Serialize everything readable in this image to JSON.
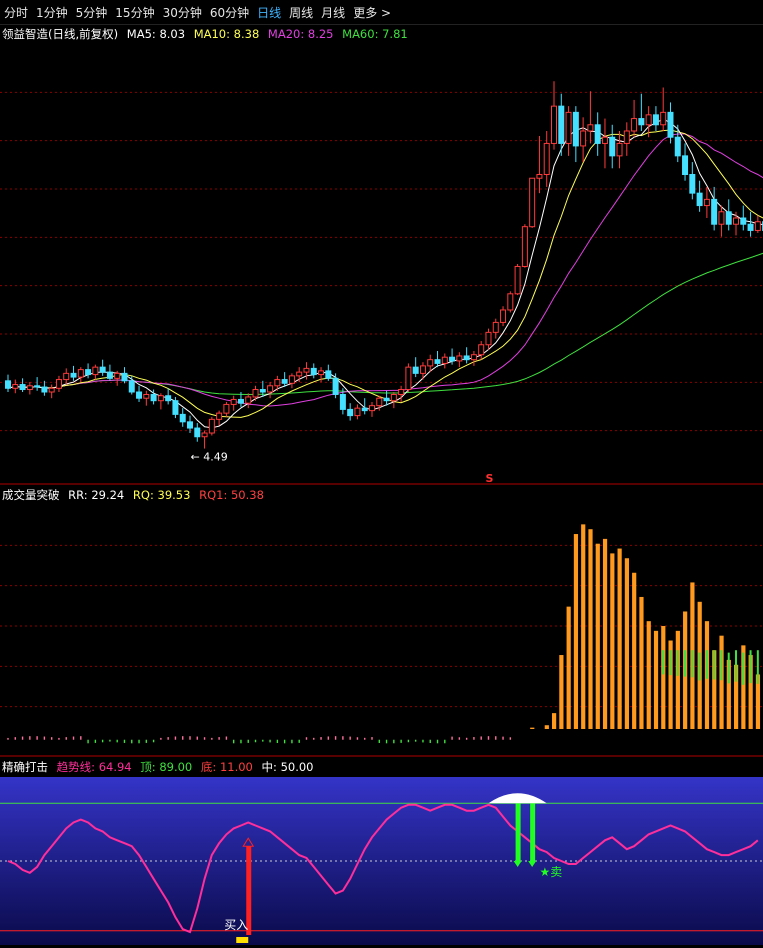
{
  "toolbar": {
    "items": [
      "分时",
      "1分钟",
      "5分钟",
      "15分钟",
      "30分钟",
      "60分钟",
      "日线",
      "周线",
      "月线",
      "更多 >"
    ],
    "active_index": 6
  },
  "colors": {
    "up": "#ff3b3b",
    "down": "#45e0ff",
    "ma5": "#ffffff",
    "ma10": "#ffff55",
    "ma20": "#e040e0",
    "ma60": "#3fe03f",
    "grid": "#8b0000",
    "orange": "#ff9a1e",
    "green_bar": "#3fe03f",
    "osc_line": "#ff2e9a"
  },
  "main": {
    "title": "领益智造(日线,前复权)",
    "ma5_label": "MA5:",
    "ma5_value": "8.03",
    "ma10_label": "MA10:",
    "ma10_value": "8.38",
    "ma20_label": "MA20:",
    "ma20_value": "8.25",
    "ma60_label": "MA60:",
    "ma60_value": "7.81",
    "low_annotation": "4.49",
    "marker_s": "S"
  },
  "volume": {
    "title": "成交量突破",
    "rr_label": "RR:",
    "rr_value": "29.24",
    "rq_label": "RQ:",
    "rq_value": "39.53",
    "rq1_label": "RQ1:",
    "rq1_value": "50.38"
  },
  "osc": {
    "title": "精确打击",
    "trend_label": "趋势线:",
    "trend_value": "64.94",
    "top_label": "顶:",
    "top_value": "89.00",
    "bottom_label": "底:",
    "bottom_value": "11.00",
    "mid_label": "中:",
    "mid_value": "50.00",
    "buy_label": "买入",
    "sell_label": "★卖"
  },
  "chart_data": [
    {
      "type": "candlestick",
      "title": "领益智造(日线,前复权)",
      "x": "trading day index",
      "ylim": [
        4.0,
        11.0
      ],
      "candles": [
        {
          "o": 5.58,
          "h": 5.68,
          "l": 5.4,
          "c": 5.46
        },
        {
          "o": 5.46,
          "h": 5.6,
          "l": 5.38,
          "c": 5.52
        },
        {
          "o": 5.52,
          "h": 5.62,
          "l": 5.4,
          "c": 5.44
        },
        {
          "o": 5.44,
          "h": 5.56,
          "l": 5.36,
          "c": 5.5
        },
        {
          "o": 5.5,
          "h": 5.64,
          "l": 5.42,
          "c": 5.48
        },
        {
          "o": 5.48,
          "h": 5.58,
          "l": 5.34,
          "c": 5.4
        },
        {
          "o": 5.4,
          "h": 5.52,
          "l": 5.3,
          "c": 5.46
        },
        {
          "o": 5.46,
          "h": 5.66,
          "l": 5.4,
          "c": 5.6
        },
        {
          "o": 5.6,
          "h": 5.78,
          "l": 5.52,
          "c": 5.7
        },
        {
          "o": 5.7,
          "h": 5.82,
          "l": 5.58,
          "c": 5.64
        },
        {
          "o": 5.64,
          "h": 5.8,
          "l": 5.56,
          "c": 5.76
        },
        {
          "o": 5.76,
          "h": 5.86,
          "l": 5.62,
          "c": 5.68
        },
        {
          "o": 5.68,
          "h": 5.84,
          "l": 5.6,
          "c": 5.8
        },
        {
          "o": 5.8,
          "h": 5.92,
          "l": 5.66,
          "c": 5.72
        },
        {
          "o": 5.72,
          "h": 5.84,
          "l": 5.58,
          "c": 5.62
        },
        {
          "o": 5.62,
          "h": 5.74,
          "l": 5.5,
          "c": 5.7
        },
        {
          "o": 5.7,
          "h": 5.8,
          "l": 5.54,
          "c": 5.58
        },
        {
          "o": 5.58,
          "h": 5.66,
          "l": 5.36,
          "c": 5.4
        },
        {
          "o": 5.4,
          "h": 5.5,
          "l": 5.24,
          "c": 5.3
        },
        {
          "o": 5.3,
          "h": 5.42,
          "l": 5.18,
          "c": 5.36
        },
        {
          "o": 5.36,
          "h": 5.44,
          "l": 5.2,
          "c": 5.26
        },
        {
          "o": 5.26,
          "h": 5.38,
          "l": 5.12,
          "c": 5.34
        },
        {
          "o": 5.34,
          "h": 5.46,
          "l": 5.2,
          "c": 5.26
        },
        {
          "o": 5.26,
          "h": 5.32,
          "l": 4.98,
          "c": 5.04
        },
        {
          "o": 5.04,
          "h": 5.14,
          "l": 4.84,
          "c": 4.92
        },
        {
          "o": 4.92,
          "h": 5.02,
          "l": 4.74,
          "c": 4.82
        },
        {
          "o": 4.82,
          "h": 4.9,
          "l": 4.6,
          "c": 4.68
        },
        {
          "o": 4.68,
          "h": 4.78,
          "l": 4.49,
          "c": 4.74
        },
        {
          "o": 4.74,
          "h": 5.0,
          "l": 4.7,
          "c": 4.96
        },
        {
          "o": 4.96,
          "h": 5.1,
          "l": 4.86,
          "c": 5.06
        },
        {
          "o": 5.06,
          "h": 5.24,
          "l": 5.0,
          "c": 5.2
        },
        {
          "o": 5.2,
          "h": 5.34,
          "l": 5.1,
          "c": 5.28
        },
        {
          "o": 5.28,
          "h": 5.4,
          "l": 5.16,
          "c": 5.22
        },
        {
          "o": 5.22,
          "h": 5.38,
          "l": 5.14,
          "c": 5.32
        },
        {
          "o": 5.32,
          "h": 5.5,
          "l": 5.26,
          "c": 5.44
        },
        {
          "o": 5.44,
          "h": 5.58,
          "l": 5.32,
          "c": 5.4
        },
        {
          "o": 5.4,
          "h": 5.56,
          "l": 5.3,
          "c": 5.5
        },
        {
          "o": 5.5,
          "h": 5.66,
          "l": 5.42,
          "c": 5.6
        },
        {
          "o": 5.6,
          "h": 5.72,
          "l": 5.48,
          "c": 5.54
        },
        {
          "o": 5.54,
          "h": 5.7,
          "l": 5.46,
          "c": 5.66
        },
        {
          "o": 5.66,
          "h": 5.8,
          "l": 5.56,
          "c": 5.72
        },
        {
          "o": 5.72,
          "h": 5.88,
          "l": 5.6,
          "c": 5.78
        },
        {
          "o": 5.78,
          "h": 5.86,
          "l": 5.62,
          "c": 5.68
        },
        {
          "o": 5.68,
          "h": 5.8,
          "l": 5.56,
          "c": 5.74
        },
        {
          "o": 5.74,
          "h": 5.84,
          "l": 5.58,
          "c": 5.62
        },
        {
          "o": 5.62,
          "h": 5.7,
          "l": 5.3,
          "c": 5.36
        },
        {
          "o": 5.36,
          "h": 5.46,
          "l": 5.04,
          "c": 5.12
        },
        {
          "o": 5.12,
          "h": 5.22,
          "l": 4.94,
          "c": 5.02
        },
        {
          "o": 5.02,
          "h": 5.2,
          "l": 4.96,
          "c": 5.14
        },
        {
          "o": 5.14,
          "h": 5.3,
          "l": 5.04,
          "c": 5.1
        },
        {
          "o": 5.1,
          "h": 5.24,
          "l": 5.0,
          "c": 5.18
        },
        {
          "o": 5.18,
          "h": 5.34,
          "l": 5.1,
          "c": 5.3
        },
        {
          "o": 5.3,
          "h": 5.42,
          "l": 5.18,
          "c": 5.26
        },
        {
          "o": 5.26,
          "h": 5.4,
          "l": 5.14,
          "c": 5.36
        },
        {
          "o": 5.36,
          "h": 5.5,
          "l": 5.24,
          "c": 5.44
        },
        {
          "o": 5.44,
          "h": 5.86,
          "l": 5.4,
          "c": 5.8
        },
        {
          "o": 5.8,
          "h": 5.96,
          "l": 5.64,
          "c": 5.7
        },
        {
          "o": 5.7,
          "h": 5.88,
          "l": 5.6,
          "c": 5.82
        },
        {
          "o": 5.82,
          "h": 6.0,
          "l": 5.72,
          "c": 5.92
        },
        {
          "o": 5.92,
          "h": 6.06,
          "l": 5.8,
          "c": 5.86
        },
        {
          "o": 5.86,
          "h": 6.02,
          "l": 5.78,
          "c": 5.96
        },
        {
          "o": 5.96,
          "h": 6.1,
          "l": 5.84,
          "c": 5.9
        },
        {
          "o": 5.9,
          "h": 6.04,
          "l": 5.8,
          "c": 5.98
        },
        {
          "o": 5.98,
          "h": 6.12,
          "l": 5.86,
          "c": 5.92
        },
        {
          "o": 5.92,
          "h": 6.06,
          "l": 5.82,
          "c": 6.0
        },
        {
          "o": 6.0,
          "h": 6.22,
          "l": 5.92,
          "c": 6.16
        },
        {
          "o": 6.16,
          "h": 6.42,
          "l": 6.08,
          "c": 6.36
        },
        {
          "o": 6.36,
          "h": 6.58,
          "l": 6.26,
          "c": 6.52
        },
        {
          "o": 6.52,
          "h": 6.78,
          "l": 6.46,
          "c": 6.72
        },
        {
          "o": 6.72,
          "h": 7.02,
          "l": 6.68,
          "c": 6.98
        },
        {
          "o": 6.98,
          "h": 7.46,
          "l": 6.96,
          "c": 7.42
        },
        {
          "o": 7.42,
          "h": 8.1,
          "l": 7.4,
          "c": 8.06
        },
        {
          "o": 8.06,
          "h": 8.84,
          "l": 8.04,
          "c": 8.84
        },
        {
          "o": 8.84,
          "h": 9.52,
          "l": 8.6,
          "c": 8.9
        },
        {
          "o": 8.9,
          "h": 9.6,
          "l": 8.7,
          "c": 9.4
        },
        {
          "o": 9.4,
          "h": 10.4,
          "l": 9.3,
          "c": 10.0
        },
        {
          "o": 10.0,
          "h": 10.2,
          "l": 9.2,
          "c": 9.4
        },
        {
          "o": 9.4,
          "h": 10.0,
          "l": 9.2,
          "c": 9.9
        },
        {
          "o": 9.9,
          "h": 10.0,
          "l": 9.1,
          "c": 9.36
        },
        {
          "o": 9.36,
          "h": 9.82,
          "l": 9.1,
          "c": 9.6
        },
        {
          "o": 9.6,
          "h": 10.24,
          "l": 9.4,
          "c": 9.7
        },
        {
          "o": 9.7,
          "h": 9.9,
          "l": 9.2,
          "c": 9.4
        },
        {
          "o": 9.4,
          "h": 9.8,
          "l": 9.0,
          "c": 9.5
        },
        {
          "o": 9.5,
          "h": 9.7,
          "l": 9.0,
          "c": 9.2
        },
        {
          "o": 9.2,
          "h": 9.6,
          "l": 9.0,
          "c": 9.4
        },
        {
          "o": 9.4,
          "h": 9.74,
          "l": 9.2,
          "c": 9.6
        },
        {
          "o": 9.6,
          "h": 10.1,
          "l": 9.5,
          "c": 9.8
        },
        {
          "o": 9.8,
          "h": 10.2,
          "l": 9.6,
          "c": 9.7
        },
        {
          "o": 9.7,
          "h": 10.0,
          "l": 9.5,
          "c": 9.86
        },
        {
          "o": 9.86,
          "h": 10.0,
          "l": 9.6,
          "c": 9.7
        },
        {
          "o": 9.7,
          "h": 10.3,
          "l": 9.6,
          "c": 9.9
        },
        {
          "o": 9.9,
          "h": 10.06,
          "l": 9.4,
          "c": 9.5
        },
        {
          "o": 9.5,
          "h": 9.7,
          "l": 9.1,
          "c": 9.2
        },
        {
          "o": 9.2,
          "h": 9.4,
          "l": 8.8,
          "c": 8.9
        },
        {
          "o": 8.9,
          "h": 9.1,
          "l": 8.5,
          "c": 8.6
        },
        {
          "o": 8.6,
          "h": 8.8,
          "l": 8.3,
          "c": 8.4
        },
        {
          "o": 8.4,
          "h": 8.7,
          "l": 8.2,
          "c": 8.5
        },
        {
          "o": 8.5,
          "h": 8.7,
          "l": 8.0,
          "c": 8.1
        },
        {
          "o": 8.1,
          "h": 8.4,
          "l": 7.9,
          "c": 8.3
        },
        {
          "o": 8.3,
          "h": 8.5,
          "l": 8.0,
          "c": 8.1
        },
        {
          "o": 8.1,
          "h": 8.3,
          "l": 7.92,
          "c": 8.2
        },
        {
          "o": 8.2,
          "h": 8.4,
          "l": 8.0,
          "c": 8.1
        },
        {
          "o": 8.1,
          "h": 8.3,
          "l": 7.9,
          "c": 8.0
        },
        {
          "o": 8.0,
          "h": 8.24,
          "l": 7.96,
          "c": 8.14
        },
        {
          "o": 8.14,
          "h": 8.3,
          "l": 7.9,
          "c": 8.0
        },
        {
          "o": 8.0,
          "h": 8.3,
          "l": 7.96,
          "c": 8.2
        },
        {
          "o": 8.2,
          "h": 8.7,
          "l": 8.1,
          "c": 8.6
        },
        {
          "o": 8.6,
          "h": 8.76,
          "l": 8.2,
          "c": 8.3
        }
      ],
      "series": [
        {
          "name": "MA5",
          "last": 8.03
        },
        {
          "name": "MA10",
          "last": 8.38
        },
        {
          "name": "MA20",
          "last": 8.25
        },
        {
          "name": "MA60",
          "last": 7.81
        }
      ],
      "annotations": [
        "4.49",
        "S"
      ]
    },
    {
      "type": "bar",
      "title": "成交量突破",
      "x": "trading day index",
      "ylim": [
        0,
        100
      ],
      "series": [
        {
          "name": "RR",
          "last": 29.24
        },
        {
          "name": "RQ",
          "last": 39.53
        },
        {
          "name": "RQ1",
          "last": 50.38
        }
      ],
      "orange_values": [
        0,
        0,
        0,
        0,
        0,
        0,
        0,
        0,
        0,
        0,
        0,
        0,
        0,
        0,
        0,
        0,
        0,
        0,
        0,
        0,
        0,
        0,
        0,
        0,
        0,
        0,
        0,
        0,
        0,
        0,
        0,
        0,
        0,
        0,
        0,
        0,
        0,
        0,
        0,
        0,
        0,
        0,
        0,
        0,
        0,
        0,
        0,
        0,
        0,
        0,
        0,
        0,
        0,
        0,
        0,
        0,
        0,
        0,
        0,
        0,
        0,
        0,
        0,
        0,
        0,
        0,
        0,
        0,
        0,
        0,
        4,
        3,
        8,
        6,
        9,
        14,
        38,
        58,
        88,
        92,
        90,
        84,
        86,
        80,
        82,
        78,
        72,
        62,
        52,
        48,
        50,
        44,
        48,
        56,
        68,
        60,
        52,
        40,
        46,
        36,
        34,
        42,
        38,
        30
      ],
      "green_band_top": [
        40,
        40,
        40,
        40,
        40,
        39,
        40,
        40,
        40,
        39,
        40,
        39,
        40,
        40,
        40,
        40,
        40,
        40,
        40,
        40,
        40,
        40,
        39
      ]
    },
    {
      "type": "line",
      "title": "精确打击",
      "x": "trading day index",
      "ylim": [
        0,
        100
      ],
      "series": [
        {
          "name": "趋势线",
          "values": [
            50,
            48,
            44,
            42,
            46,
            54,
            60,
            66,
            72,
            76,
            78,
            76,
            72,
            70,
            66,
            64,
            62,
            60,
            54,
            46,
            38,
            30,
            22,
            12,
            4,
            2,
            18,
            38,
            54,
            62,
            68,
            72,
            74,
            76,
            74,
            72,
            70,
            66,
            62,
            58,
            54,
            52,
            46,
            40,
            34,
            28,
            30,
            38,
            48,
            58,
            66,
            72,
            78,
            82,
            86,
            88,
            88,
            86,
            84,
            86,
            88,
            88,
            86,
            84,
            84,
            86,
            88,
            86,
            80,
            74,
            70,
            66,
            62,
            58,
            56,
            52,
            50,
            48,
            48,
            52,
            56,
            60,
            64,
            66,
            62,
            58,
            60,
            64,
            68,
            70,
            72,
            74,
            72,
            70,
            66,
            62,
            58,
            56,
            54,
            54,
            56,
            58,
            60,
            64
          ]
        }
      ],
      "reference_lines": {
        "顶": 89.0,
        "底": 11.0,
        "中": 50.0
      },
      "last": 64.94,
      "annotations": [
        "买入",
        "★卖"
      ]
    }
  ]
}
